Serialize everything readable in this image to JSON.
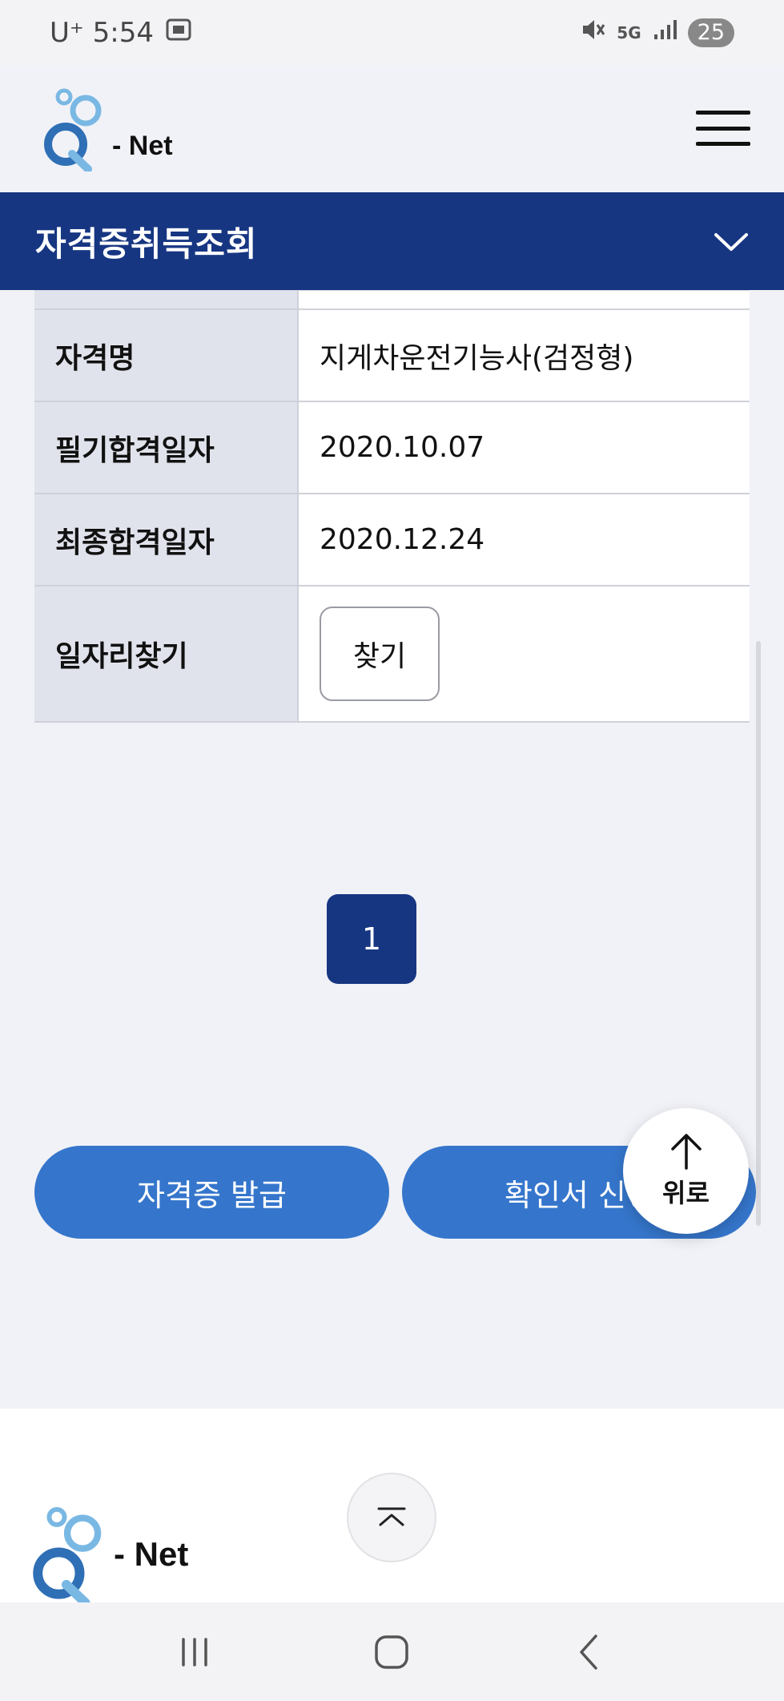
{
  "status_bar": {
    "carrier_time": "U⁺ 5:54",
    "network": "5G",
    "battery": "25"
  },
  "header": {
    "logo_text": "- Net"
  },
  "title_bar": {
    "title": "자격증취득조회"
  },
  "details": {
    "rows": [
      {
        "label": "자격명",
        "value": "지게차운전기능사(검정형)"
      },
      {
        "label": "필기합격일자",
        "value": "2020.10.07"
      },
      {
        "label": "최종합격일자",
        "value": "2020.12.24"
      },
      {
        "label": "일자리찾기",
        "button": "찾기"
      }
    ]
  },
  "pagination": {
    "current_page": "1"
  },
  "actions": {
    "issue_label": "자격증 발급",
    "confirm_label": "확인서 신청"
  },
  "scroll_top": {
    "label": "위로"
  },
  "footer": {
    "logo_text": "- Net"
  },
  "colors": {
    "brand_navy": "#173682",
    "action_blue": "#3576cc",
    "logo_blue": "#2f6fb5",
    "logo_light": "#7ab8e4"
  }
}
